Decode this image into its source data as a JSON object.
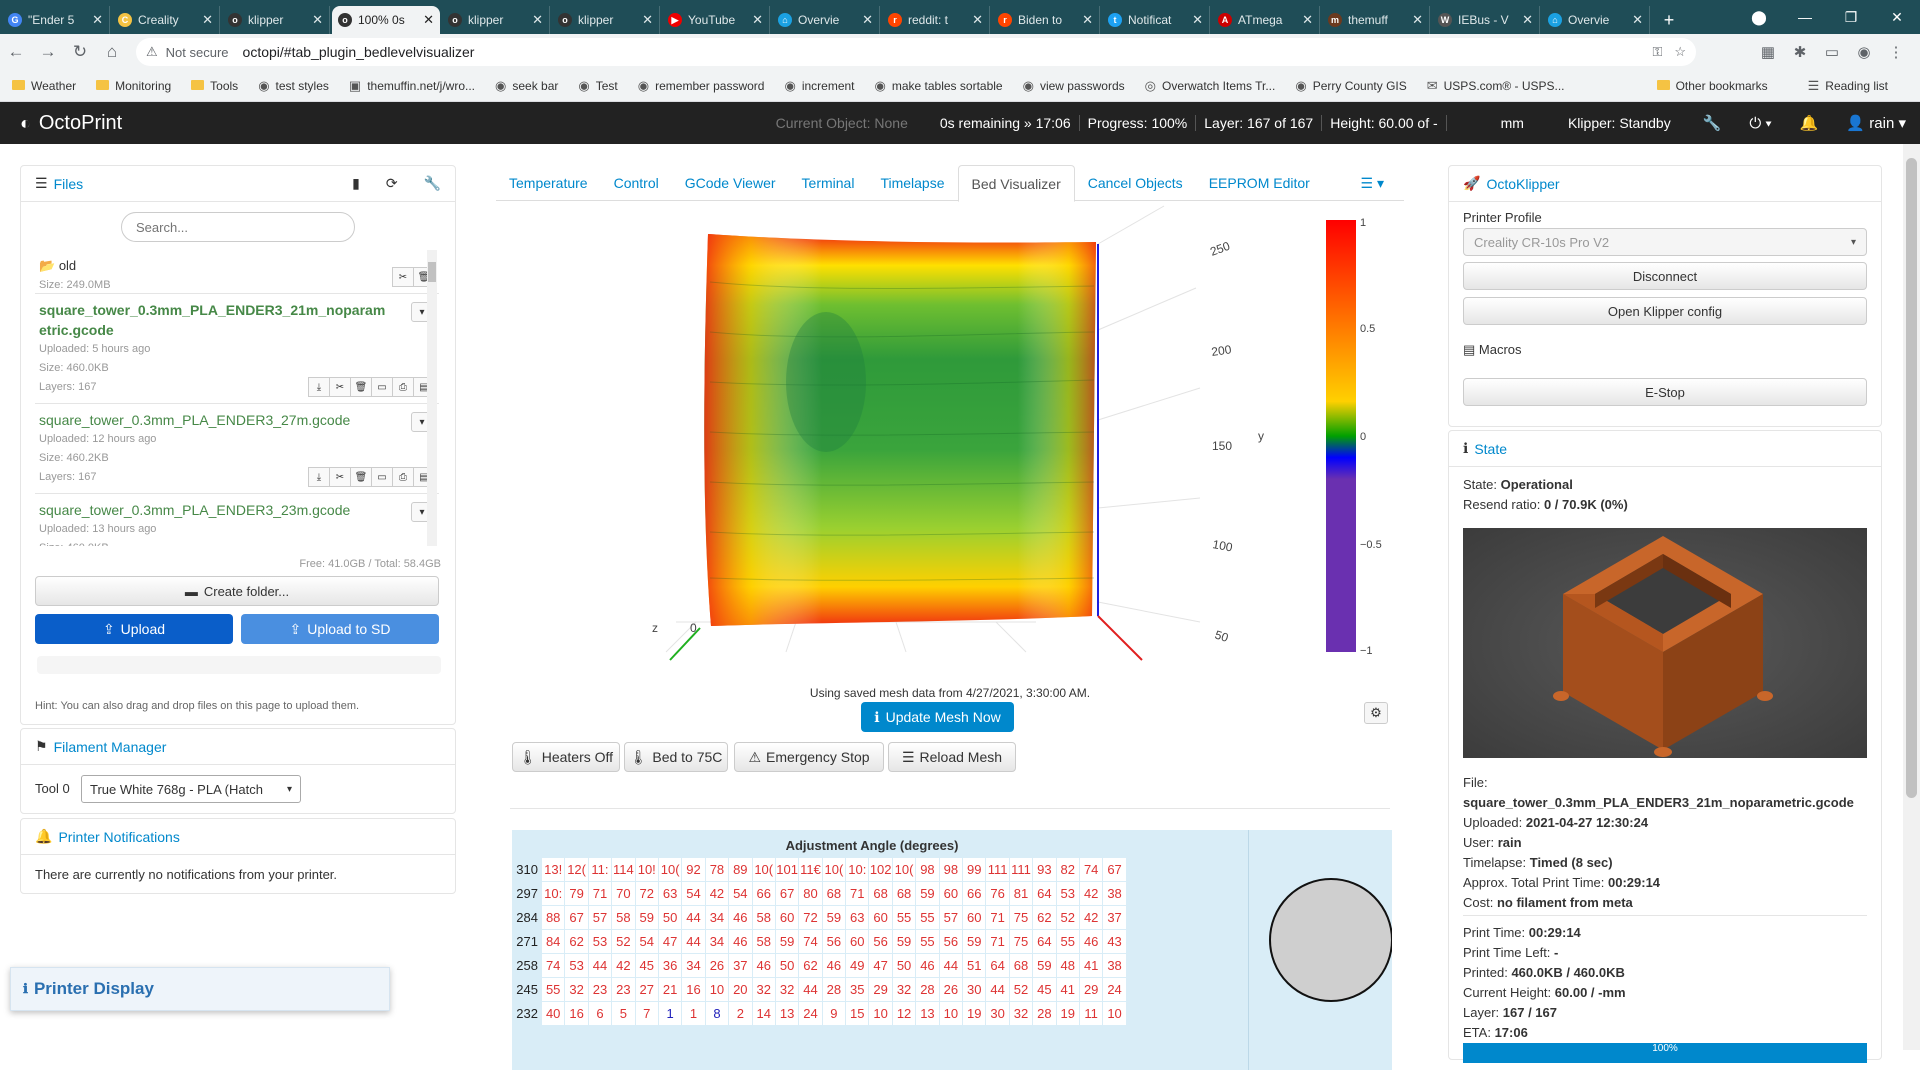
{
  "browser": {
    "tabs": [
      {
        "title": "\"Ender 5",
        "fav": "G",
        "color": "#4285f4"
      },
      {
        "title": "Creality",
        "fav": "C",
        "color": "#f5c343"
      },
      {
        "title": "klipper",
        "fav": "o",
        "color": "#333"
      },
      {
        "title": "100% 0s",
        "fav": "o",
        "color": "#333",
        "active": true
      },
      {
        "title": "klipper",
        "fav": "o",
        "color": "#333"
      },
      {
        "title": "klipper",
        "fav": "o",
        "color": "#333"
      },
      {
        "title": "YouTube",
        "fav": "▶",
        "color": "#e00"
      },
      {
        "title": "Overvie",
        "fav": "⌂",
        "color": "#1ba1e2"
      },
      {
        "title": "reddit: t",
        "fav": "r",
        "color": "#ff4500"
      },
      {
        "title": "Biden to",
        "fav": "r",
        "color": "#ff4500"
      },
      {
        "title": "Notificat",
        "fav": "t",
        "color": "#1da1f2"
      },
      {
        "title": "ATmega",
        "fav": "A",
        "color": "#c00"
      },
      {
        "title": "themuff",
        "fav": "m",
        "color": "#6b3a1f"
      },
      {
        "title": "IEBus - V",
        "fav": "W",
        "color": "#555"
      },
      {
        "title": "Overvie",
        "fav": "⌂",
        "color": "#1ba1e2"
      }
    ],
    "security": "Not secure",
    "url": "octopi/#tab_plugin_bedlevelvisualizer",
    "bookmarks": [
      {
        "label": "Weather",
        "kind": "folder"
      },
      {
        "label": "Monitoring",
        "kind": "folder"
      },
      {
        "label": "Tools",
        "kind": "folder"
      },
      {
        "label": "test styles",
        "kind": "octo"
      },
      {
        "label": "themuffin.net/j/wro...",
        "kind": "img"
      },
      {
        "label": "seek bar",
        "kind": "octo"
      },
      {
        "label": "Test",
        "kind": "octo"
      },
      {
        "label": "remember password",
        "kind": "octo"
      },
      {
        "label": "increment",
        "kind": "octo"
      },
      {
        "label": "make tables sortable",
        "kind": "octo"
      },
      {
        "label": "view passwords",
        "kind": "octo"
      },
      {
        "label": "Overwatch Items Tr...",
        "kind": "ow"
      },
      {
        "label": "Perry County GIS",
        "kind": "octo"
      },
      {
        "label": "USPS.com® - USPS...",
        "kind": "usps"
      }
    ],
    "bookmarks_right": [
      "Other bookmarks",
      "Reading list"
    ]
  },
  "navbar": {
    "brand": "OctoPrint",
    "current_object": "Current Object: None",
    "remaining": "0s remaining » 17:06",
    "progress": "Progress: 100%",
    "layer": "Layer: 167 of 167",
    "height": "Height: 60.00 of -",
    "unit": "mm",
    "klipper": "Klipper: Standby",
    "user": "rain"
  },
  "files": {
    "title": "Files",
    "search_placeholder": "Search...",
    "folder": {
      "name": "old",
      "size": "Size: 249.0MB"
    },
    "entries": [
      {
        "name": "square_tower_0.3mm_PLA_ENDER3_21m_noparametric.gcode",
        "uploaded": "Uploaded: 5 hours ago",
        "size": "Size: 460.0KB",
        "layers": "Layers: 167",
        "bold": true
      },
      {
        "name": "square_tower_0.3mm_PLA_ENDER3_27m.gcode",
        "uploaded": "Uploaded: 12 hours ago",
        "size": "Size: 460.2KB",
        "layers": "Layers: 167",
        "bold": false
      },
      {
        "name": "square_tower_0.3mm_PLA_ENDER3_23m.gcode",
        "uploaded": "Uploaded: 13 hours ago",
        "size": "Size: 460.0KB",
        "layers": "",
        "bold": false
      }
    ],
    "free_total": "Free: 41.0GB / Total: 58.4GB",
    "create_folder": "Create folder...",
    "upload": "Upload",
    "upload_sd": "Upload to SD",
    "hint": "Hint: You can also drag and drop files on this page to upload them."
  },
  "filament": {
    "title": "Filament Manager",
    "tool_label": "Tool 0",
    "tool_value": "True White 768g - PLA (Hatch"
  },
  "notifications": {
    "title": "Printer Notifications",
    "message": "There are currently no notifications from your printer."
  },
  "printer_display": "Printer Display",
  "tabs": [
    "Temperature",
    "Control",
    "GCode Viewer",
    "Terminal",
    "Timelapse",
    "Bed Visualizer",
    "Cancel Objects",
    "EEPROM Editor"
  ],
  "active_tab": "Bed Visualizer",
  "mesh": {
    "axis_y_ticks": [
      "250",
      "200",
      "150",
      "100",
      "50"
    ],
    "y_label": "y",
    "z_label": "z",
    "zero_label": "0",
    "colorbar_ticks": [
      "1",
      "0.5",
      "0",
      "−0.5",
      "−1"
    ],
    "note": "Using saved mesh data from 4/27/2021, 3:30:00 AM.",
    "update_btn": "Update Mesh Now",
    "commands": [
      "Heaters Off",
      "Bed to 75C",
      "Emergency Stop",
      "Reload Mesh"
    ],
    "table_title": "Adjustment Angle (degrees)",
    "rows": [
      {
        "label": "310",
        "values": [
          "13!",
          "12(",
          "11:",
          "114",
          "10!",
          "10(",
          "92",
          "78",
          "89",
          "10(",
          "101",
          "11€",
          "10(",
          "10:",
          "102",
          "10(",
          "98",
          "98",
          "99",
          "111",
          "111",
          "93",
          "82",
          "74",
          "67"
        ]
      },
      {
        "label": "297",
        "values": [
          "10:",
          "79",
          "71",
          "70",
          "72",
          "63",
          "54",
          "42",
          "54",
          "66",
          "67",
          "80",
          "68",
          "71",
          "68",
          "68",
          "59",
          "60",
          "66",
          "76",
          "81",
          "64",
          "53",
          "42",
          "38"
        ]
      },
      {
        "label": "284",
        "values": [
          "88",
          "67",
          "57",
          "58",
          "59",
          "50",
          "44",
          "34",
          "46",
          "58",
          "60",
          "72",
          "59",
          "63",
          "60",
          "55",
          "55",
          "57",
          "60",
          "71",
          "75",
          "62",
          "52",
          "42",
          "37"
        ]
      },
      {
        "label": "271",
        "values": [
          "84",
          "62",
          "53",
          "52",
          "54",
          "47",
          "44",
          "34",
          "46",
          "58",
          "59",
          "74",
          "56",
          "60",
          "56",
          "59",
          "55",
          "56",
          "59",
          "71",
          "75",
          "64",
          "55",
          "46",
          "43"
        ]
      },
      {
        "label": "258",
        "values": [
          "74",
          "53",
          "44",
          "42",
          "45",
          "36",
          "34",
          "26",
          "37",
          "46",
          "50",
          "62",
          "46",
          "49",
          "47",
          "50",
          "46",
          "44",
          "51",
          "64",
          "68",
          "59",
          "48",
          "41",
          "38"
        ]
      },
      {
        "label": "245",
        "values": [
          "55",
          "32",
          "23",
          "23",
          "27",
          "21",
          "16",
          "10",
          "20",
          "32",
          "32",
          "44",
          "28",
          "35",
          "29",
          "32",
          "28",
          "26",
          "30",
          "44",
          "52",
          "45",
          "41",
          "29",
          "24"
        ]
      },
      {
        "label": "232",
        "values": [
          "40",
          "16",
          "6",
          "5",
          "7",
          "1",
          "1",
          "8",
          "2",
          "14",
          "13",
          "24",
          "9",
          "15",
          "10",
          "12",
          "13",
          "10",
          "19",
          "30",
          "32",
          "28",
          "19",
          "11",
          "10"
        ]
      }
    ]
  },
  "octoklipper": {
    "title": "OctoKlipper",
    "profile_label": "Printer Profile",
    "profile_value": "Creality CR-10s Pro V2",
    "disconnect": "Disconnect",
    "open_config": "Open Klipper config",
    "macros_label": "Macros",
    "estop": "E-Stop"
  },
  "state": {
    "title": "State",
    "state_label": "State:",
    "state_value": "Operational",
    "resend_label": "Resend ratio:",
    "resend_value": "0 / 70.9K (0%)",
    "file_label": "File:",
    "file_value": "square_tower_0.3mm_PLA_ENDER3_21m_noparametric.gcode",
    "uploaded_label": "Uploaded:",
    "uploaded_value": "2021-04-27 12:30:24",
    "user_label": "User:",
    "user_value": "rain",
    "timelapse_label": "Timelapse:",
    "timelapse_value": "Timed (8 sec)",
    "approx_label": "Approx. Total Print Time:",
    "approx_value": "00:29:14",
    "cost_label": "Cost:",
    "cost_value": "no filament from meta",
    "ptime_label": "Print Time:",
    "ptime_value": "00:29:14",
    "pleft_label": "Print Time Left:",
    "pleft_value": "-",
    "printed_label": "Printed:",
    "printed_value": "460.0KB / 460.0KB",
    "cheight_label": "Current Height:",
    "cheight_value": "60.00 / -mm",
    "layer_label": "Layer:",
    "layer_value": "167 / 167",
    "eta_label": "ETA:",
    "eta_value": "17:06",
    "progress_text": "100%",
    "progress": 1.0
  }
}
